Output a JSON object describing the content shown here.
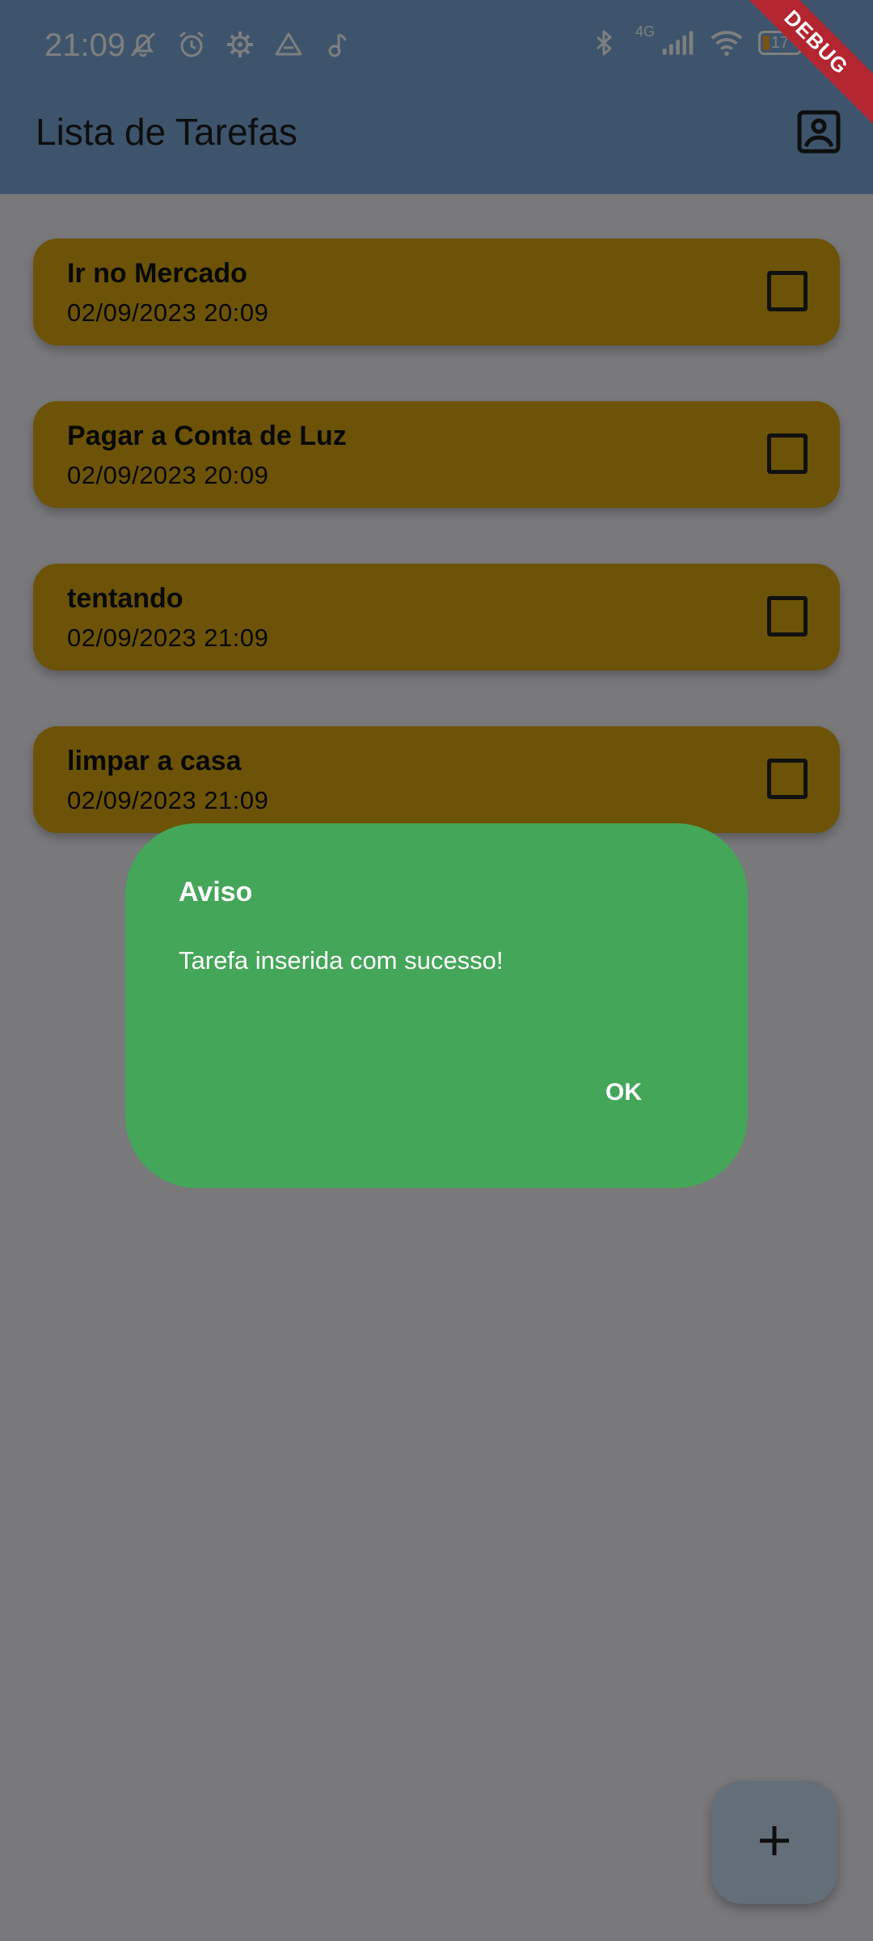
{
  "status_bar": {
    "time": "21:09",
    "left_icons": [
      "mute-bell-icon",
      "alarm-icon",
      "settings-gear-icon",
      "drive-icon",
      "music-note-icon"
    ],
    "right_icons": [
      "bluetooth-icon",
      "cellular-signal-icon",
      "wifi-icon",
      "battery-icon"
    ],
    "network_label": "4G",
    "battery_level": "17"
  },
  "debug_banner": "DEBUG",
  "app_bar": {
    "title": "Lista de Tarefas",
    "action_icon": "account-box-icon"
  },
  "tasks": [
    {
      "title": "Ir no Mercado",
      "date": "02/09/2023 20:09",
      "done": false
    },
    {
      "title": "Pagar a Conta de Luz",
      "date": "02/09/2023 20:09",
      "done": false
    },
    {
      "title": "tentando",
      "date": "02/09/2023 21:09",
      "done": false
    },
    {
      "title": "limpar a casa",
      "date": "02/09/2023 21:09",
      "done": false
    }
  ],
  "dialog": {
    "title": "Aviso",
    "message": "Tarefa inserida com sucesso!",
    "ok_label": "OK"
  },
  "fab": {
    "icon": "plus-icon"
  },
  "colors": {
    "app_bar": "#7aa9d9",
    "card": "#d8a60f",
    "dialog": "#44a658",
    "fab": "#c8dcf3",
    "debug": "#b3262f"
  }
}
